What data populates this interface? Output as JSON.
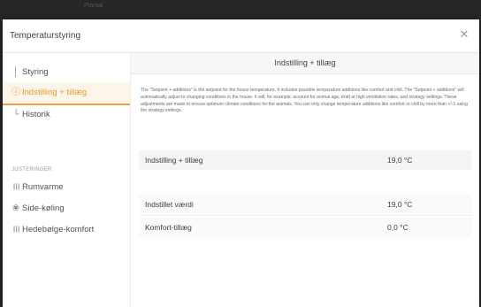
{
  "window": {
    "title_bar_text": "Plantal"
  },
  "modal": {
    "title": "Temperaturstyring",
    "close_icon": "close-icon"
  },
  "sidebar": {
    "items": [
      {
        "label": "Styring",
        "icon": "thermometer-icon",
        "glyph": "│",
        "active": false
      },
      {
        "label": "Indstilling + tillæg",
        "icon": "info-icon",
        "glyph": "ⓘ",
        "active": true
      },
      {
        "label": "Historik",
        "icon": "chart-icon",
        "glyph": "└",
        "active": false
      }
    ],
    "section_label": "JUSTERINGER",
    "adjustments": [
      {
        "label": "Rumvarme",
        "icon": "heater-icon",
        "glyph": "┃┃┃"
      },
      {
        "label": "Side-køling",
        "icon": "fan-icon",
        "glyph": "❀"
      },
      {
        "label": "Hedebølge-komfort",
        "icon": "heatwave-icon",
        "glyph": "┃┃┃"
      }
    ]
  },
  "main": {
    "title": "Indstilling + tillæg",
    "description": "The \"Setpoint + additions\" is the setpoint for the house temperature. It includes possible temperature additions like comfort and chill. The \"Setpoint + additions\" will automatically adjust to changing conditions in the house. It will, for example, account for animal age, draft at high ventilation rates, and strategy settings. These adjustments are made to ensure optimum climate conditions for the animals. You can only change temperature additions like comfort or chill by more than +/-1 using the strategy settings.",
    "summary": {
      "label": "Indstilling + tillæg",
      "value": "19,0 °C"
    },
    "rows": [
      {
        "label": "Indstillet værdi",
        "value": "19,0 °C"
      },
      {
        "label": "Komfort-tillæg",
        "value": "0,0 °C"
      }
    ]
  },
  "colors": {
    "accent": "#e39a2c",
    "active_bg": "#fdf5ea",
    "backdrop": "#262626"
  }
}
